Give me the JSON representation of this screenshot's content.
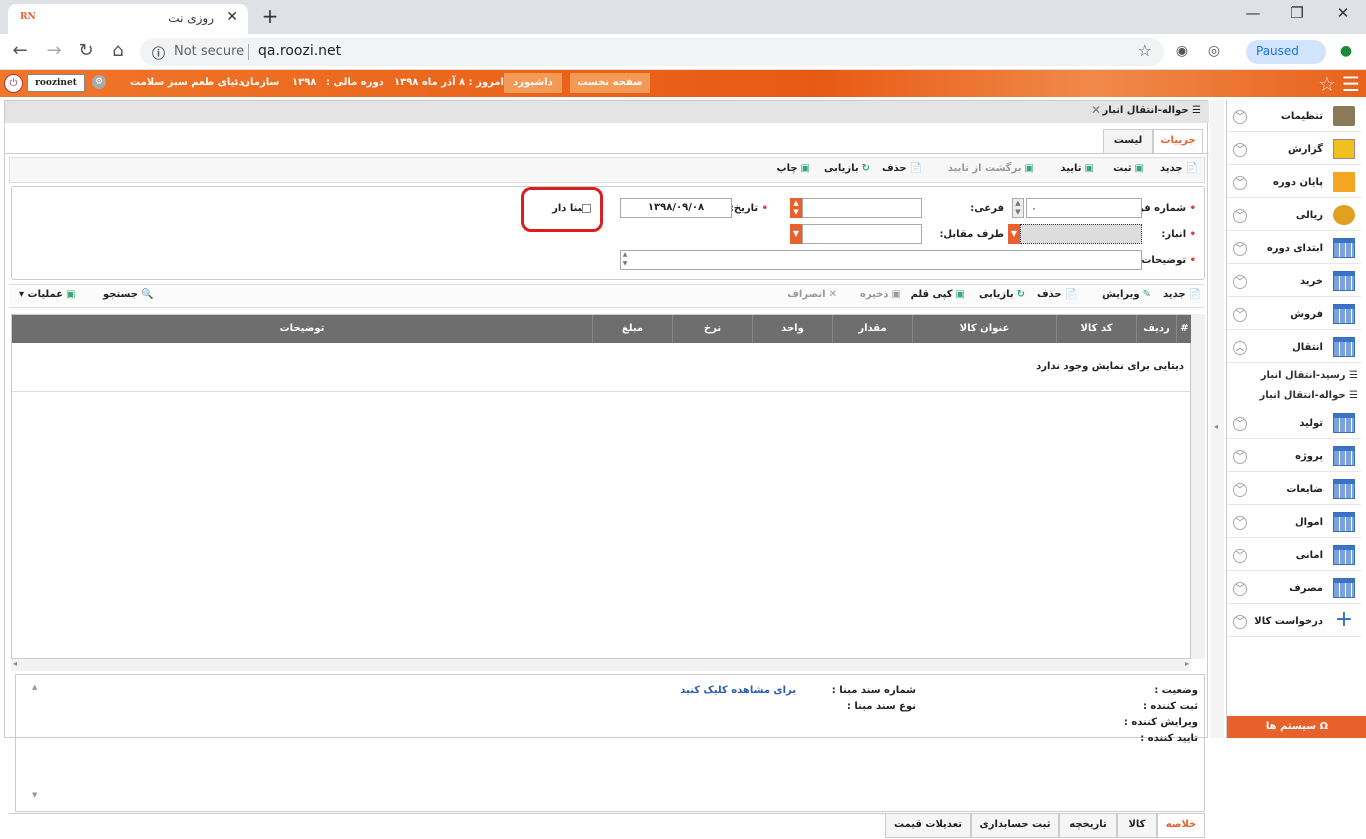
{
  "browser": {
    "tab_title": "روزی نت",
    "favicon_text": "RN",
    "url": "qa.roozi.net",
    "security": "Not secure",
    "profile_status": "Paused"
  },
  "header": {
    "user": "roozinet",
    "org_label": "سازمان :",
    "org_value": "دنیای طعم سبز سلامت",
    "period_label": "دوره مالی :",
    "period_value": "۱۳۹۸",
    "today": "امروز : ۸ آذر ماه ۱۳۹۸",
    "dashboard": "داشبورد",
    "first_page": "صفحه نخست"
  },
  "form": {
    "title": "حواله-انتقال انبار",
    "tabs": [
      "جزییات",
      "لیست"
    ],
    "toolbar": [
      "جدید",
      "ثبت",
      "تایید",
      "برگشت از تایید",
      "حذف",
      "بازیابی",
      "چاپ"
    ],
    "fields": {
      "form_number_label": "شماره فرم:",
      "form_number_value": "۰",
      "sub_label": "فرعی:",
      "date_label": "تاریخ:",
      "date_value": "۱۳۹۸/۰۹/۰۸",
      "mabna_label": "مبنا دار",
      "warehouse_label": "انبار:",
      "counterparty_label": "طرف مقابل:",
      "description_label": "توضیحات:"
    }
  },
  "items_toolbar": {
    "new": "جدید",
    "edit": "ویرایش",
    "delete": "حذف",
    "restore": "بازیابی",
    "copy": "کپی قلم",
    "save": "ذخیره",
    "cancel": "انصراف",
    "search": "جستجو",
    "operations": "عملیات"
  },
  "grid": {
    "columns": [
      "#",
      "ردیف",
      "کد کالا",
      "عنوان کالا",
      "مقدار",
      "واحد",
      "نرخ",
      "مبلغ",
      "توضیحات"
    ],
    "empty_message": "دیتایی برای نمایش وجود ندارد"
  },
  "info": {
    "status": "وضعیت :",
    "created_by": "ثبت کننده :",
    "edited_by": "ویرایش کننده :",
    "approved_by": "تایید کننده :",
    "base_doc_number": "شماره سند مبنا :",
    "base_doc_type": "نوع سند مبنا :",
    "view_link": "برای مشاهده کلیک کنید"
  },
  "bottom_tabs": [
    "خلاصه",
    "کالا",
    "تاریخچه",
    "ثبت حسابداری",
    "تعدیلات قیمت"
  ],
  "sidebar": {
    "items": [
      {
        "label": "تنظیمات",
        "icon": "settings-icon"
      },
      {
        "label": "گزارش",
        "icon": "report-icon"
      },
      {
        "label": "پایان دوره",
        "icon": "period-end-icon"
      },
      {
        "label": "ریالی",
        "icon": "money-icon"
      },
      {
        "label": "ابتدای دوره",
        "icon": "grid-icon"
      },
      {
        "label": "خرید",
        "icon": "grid-icon"
      },
      {
        "label": "فروش",
        "icon": "grid-icon"
      },
      {
        "label": "انتقال",
        "icon": "grid-icon"
      },
      {
        "label": "تولید",
        "icon": "grid-icon"
      },
      {
        "label": "پروژه",
        "icon": "grid-icon"
      },
      {
        "label": "ضایعات",
        "icon": "grid-icon"
      },
      {
        "label": "اموال",
        "icon": "grid-icon"
      },
      {
        "label": "امانی",
        "icon": "grid-icon"
      },
      {
        "label": "مصرف",
        "icon": "grid-icon"
      },
      {
        "label": "درخواست کالا",
        "icon": "plus-icon"
      }
    ],
    "subitems": [
      "رسید-انتقال انبار",
      "حواله-انتقال انبار"
    ],
    "system_button": "سیستم ها"
  }
}
